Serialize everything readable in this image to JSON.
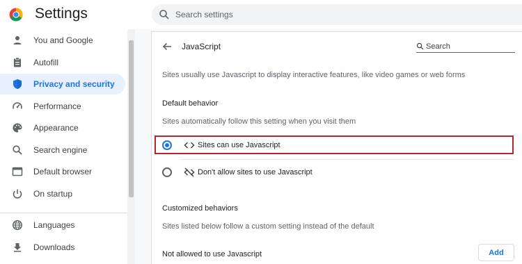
{
  "header": {
    "app_title": "Settings",
    "search_placeholder": "Search settings"
  },
  "sidebar": {
    "items": [
      {
        "label": "You and Google",
        "icon": "person-icon"
      },
      {
        "label": "Autofill",
        "icon": "clipboard-icon"
      },
      {
        "label": "Privacy and security",
        "icon": "shield-icon",
        "active": true
      },
      {
        "label": "Performance",
        "icon": "speedometer-icon"
      },
      {
        "label": "Appearance",
        "icon": "palette-icon"
      },
      {
        "label": "Search engine",
        "icon": "search-icon"
      },
      {
        "label": "Default browser",
        "icon": "browser-window-icon"
      },
      {
        "label": "On startup",
        "icon": "power-icon"
      },
      {
        "label": "Languages",
        "icon": "globe-icon"
      },
      {
        "label": "Downloads",
        "icon": "download-icon"
      }
    ]
  },
  "page": {
    "title": "JavaScript",
    "search_placeholder": "Search",
    "description": "Sites usually use Javascript to display interactive features, like video games or web forms",
    "default_behavior": {
      "title": "Default behavior",
      "subtitle": "Sites automatically follow this setting when you visit them",
      "options": [
        {
          "label": "Sites can use Javascript",
          "icon": "code-brackets-icon",
          "selected": true
        },
        {
          "label": "Don't allow sites to use Javascript",
          "icon": "code-off-icon",
          "selected": false
        }
      ]
    },
    "customized_behaviors": {
      "title": "Customized behaviors",
      "subtitle": "Sites listed below follow a custom setting instead of the default",
      "not_allowed_label": "Not allowed to use Javascript",
      "add_button": "Add"
    }
  },
  "colors": {
    "accent": "#1a73e8",
    "active_background": "#e8f0fe",
    "highlight_border": "#b3272b"
  }
}
